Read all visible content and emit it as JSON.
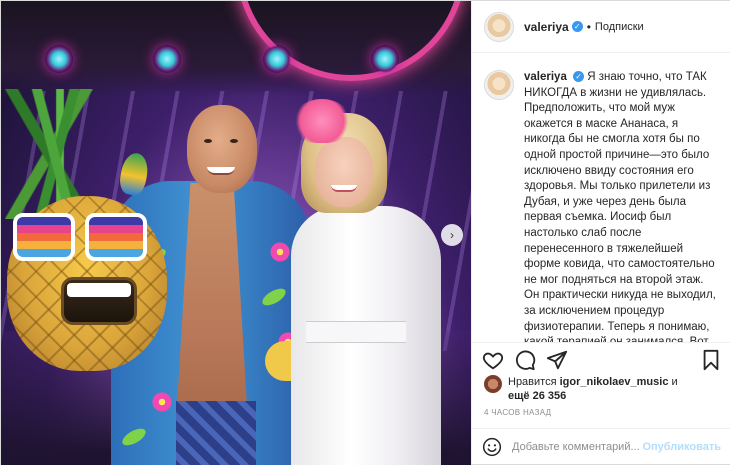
{
  "post": {
    "username": "valeriya",
    "follow_label": "Подписки",
    "dot": "•",
    "verified_mark": "✓",
    "caption": "Я знаю точно, что ТАК НИКОГДА в жизни не удивлялась. Предположить, что мой муж окажется в маске Ананаса, я никогда бы не смогла хотя бы по одной простой причине—это было исключено ввиду состояния его здоровья. Мы только прилетели из Дубая, и уже через день была первая съемка. Иосиф был настолько  слаб после перенесенного в  тяжелейшей форме ковида, что самостоятельно не мог подняться на второй этаж. Он практически никуда не выходил, за исключением процедур физиотерапии. Теперь я понимаю, какой терапией он занимался. Вот правду говорят, что деньги лечат. И",
    "likes_prefix": "Нравится",
    "likes_user": "igor_nikolaev_music",
    "likes_and": "и",
    "likes_more": "ещё 26 356",
    "time": "4 ЧАСОВ НАЗАД"
  },
  "comment": {
    "placeholder": "Добавьте комментарий...",
    "publish_label": "Опубликовать"
  },
  "icons": {
    "next": "chevron-right-icon",
    "like": "heart-icon",
    "comment": "comment-icon",
    "share": "paper-plane-icon",
    "save": "bookmark-icon",
    "emoji": "smiley-icon"
  },
  "colors": {
    "verified": "#3897f0",
    "link_disabled": "#b2dffc",
    "muted": "#8e8e8e",
    "text": "#262626"
  }
}
